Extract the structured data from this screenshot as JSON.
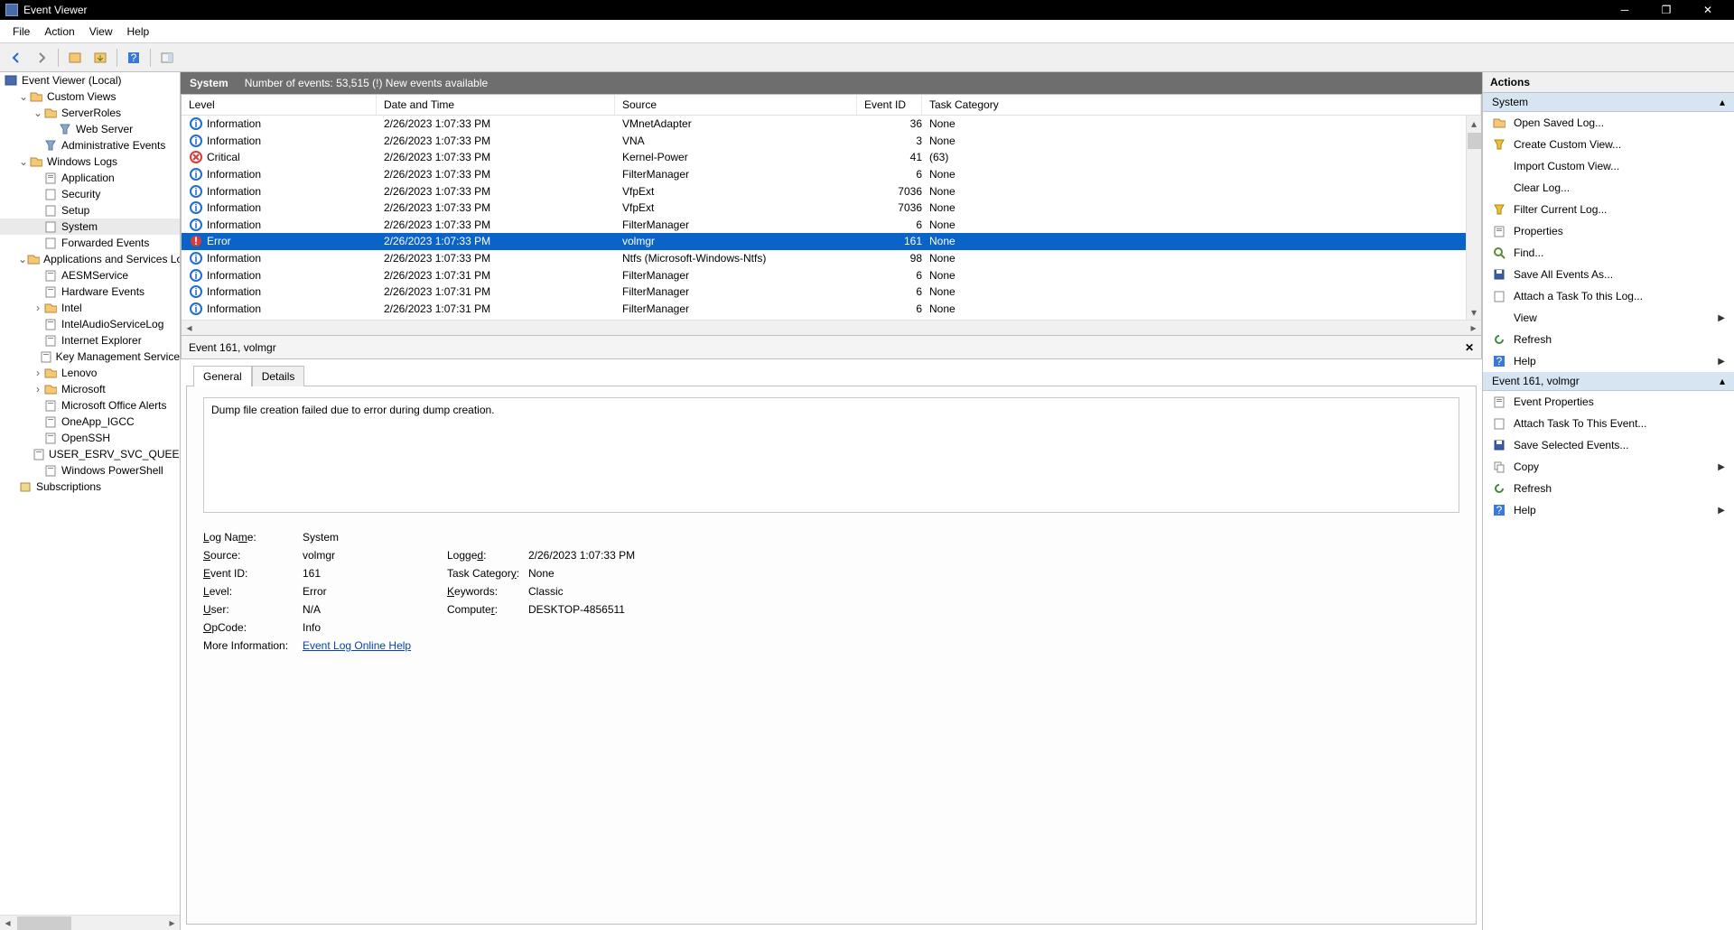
{
  "window": {
    "title": "Event Viewer"
  },
  "menu": {
    "file": "File",
    "action": "Action",
    "view": "View",
    "help": "Help"
  },
  "tree": {
    "root": "Event Viewer (Local)",
    "customViews": "Custom Views",
    "serverRoles": "ServerRoles",
    "webServer": "Web Server",
    "adminEvents": "Administrative Events",
    "windowsLogs": "Windows Logs",
    "application": "Application",
    "security": "Security",
    "setup": "Setup",
    "system": "System",
    "forwarded": "Forwarded Events",
    "appsAndServices": "Applications and Services Logs",
    "svc": [
      "AESMService",
      "Hardware Events",
      "Intel",
      "IntelAudioServiceLog",
      "Internet Explorer",
      "Key Management Service",
      "Lenovo",
      "Microsoft",
      "Microsoft Office Alerts",
      "OneApp_IGCC",
      "OpenSSH",
      "USER_ESRV_SVC_QUEENCREEK",
      "Windows PowerShell"
    ],
    "subscriptions": "Subscriptions"
  },
  "strip": {
    "title": "System",
    "count": "Number of events: 53,515 (!) New events available"
  },
  "columns": {
    "level": "Level",
    "date": "Date and Time",
    "source": "Source",
    "eventId": "Event ID",
    "taskCat": "Task Category"
  },
  "rows": [
    {
      "level": "Information",
      "date": "2/26/2023 1:07:33 PM",
      "source": "VMnetAdapter",
      "id": "36",
      "cat": "None",
      "kind": "info"
    },
    {
      "level": "Information",
      "date": "2/26/2023 1:07:33 PM",
      "source": "VNA",
      "id": "3",
      "cat": "None",
      "kind": "info"
    },
    {
      "level": "Critical",
      "date": "2/26/2023 1:07:33 PM",
      "source": "Kernel-Power",
      "id": "41",
      "cat": "(63)",
      "kind": "crit"
    },
    {
      "level": "Information",
      "date": "2/26/2023 1:07:33 PM",
      "source": "FilterManager",
      "id": "6",
      "cat": "None",
      "kind": "info"
    },
    {
      "level": "Information",
      "date": "2/26/2023 1:07:33 PM",
      "source": "VfpExt",
      "id": "7036",
      "cat": "None",
      "kind": "info"
    },
    {
      "level": "Information",
      "date": "2/26/2023 1:07:33 PM",
      "source": "VfpExt",
      "id": "7036",
      "cat": "None",
      "kind": "info"
    },
    {
      "level": "Information",
      "date": "2/26/2023 1:07:33 PM",
      "source": "FilterManager",
      "id": "6",
      "cat": "None",
      "kind": "info"
    },
    {
      "level": "Error",
      "date": "2/26/2023 1:07:33 PM",
      "source": "volmgr",
      "id": "161",
      "cat": "None",
      "kind": "err",
      "selected": true
    },
    {
      "level": "Information",
      "date": "2/26/2023 1:07:33 PM",
      "source": "Ntfs (Microsoft-Windows-Ntfs)",
      "id": "98",
      "cat": "None",
      "kind": "info"
    },
    {
      "level": "Information",
      "date": "2/26/2023 1:07:31 PM",
      "source": "FilterManager",
      "id": "6",
      "cat": "None",
      "kind": "info"
    },
    {
      "level": "Information",
      "date": "2/26/2023 1:07:31 PM",
      "source": "FilterManager",
      "id": "6",
      "cat": "None",
      "kind": "info"
    },
    {
      "level": "Information",
      "date": "2/26/2023 1:07:31 PM",
      "source": "FilterManager",
      "id": "6",
      "cat": "None",
      "kind": "info"
    }
  ],
  "detail": {
    "title": "Event 161, volmgr",
    "tabs": {
      "general": "General",
      "details": "Details"
    },
    "description": "Dump file creation failed due to error during dump creation.",
    "logNameLabel": "Log Name:",
    "logName": "System",
    "sourceLabel": "Source:",
    "source": "volmgr",
    "loggedLabel": "Logged:",
    "logged": "2/26/2023 1:07:33 PM",
    "eventIdLabel": "Event ID:",
    "eventId": "161",
    "taskCatLabel": "Task Category:",
    "taskCat": "None",
    "levelLabel": "Level:",
    "level": "Error",
    "keywordsLabel": "Keywords:",
    "keywords": "Classic",
    "userLabel": "User:",
    "user": "N/A",
    "computerLabel": "Computer:",
    "computer": "DESKTOP-4856511",
    "opcodeLabel": "OpCode:",
    "opcode": "Info",
    "moreInfoLabel": "More Information:",
    "moreInfoLink": "Event Log Online Help"
  },
  "actions": {
    "header": "Actions",
    "section1": "System",
    "items1": [
      "Open Saved Log...",
      "Create Custom View...",
      "Import Custom View...",
      "Clear Log...",
      "Filter Current Log...",
      "Properties",
      "Find...",
      "Save All Events As...",
      "Attach a Task To this Log...",
      "View",
      "Refresh",
      "Help"
    ],
    "section2": "Event 161, volmgr",
    "items2": [
      "Event Properties",
      "Attach Task To This Event...",
      "Save Selected Events...",
      "Copy",
      "Refresh",
      "Help"
    ]
  }
}
